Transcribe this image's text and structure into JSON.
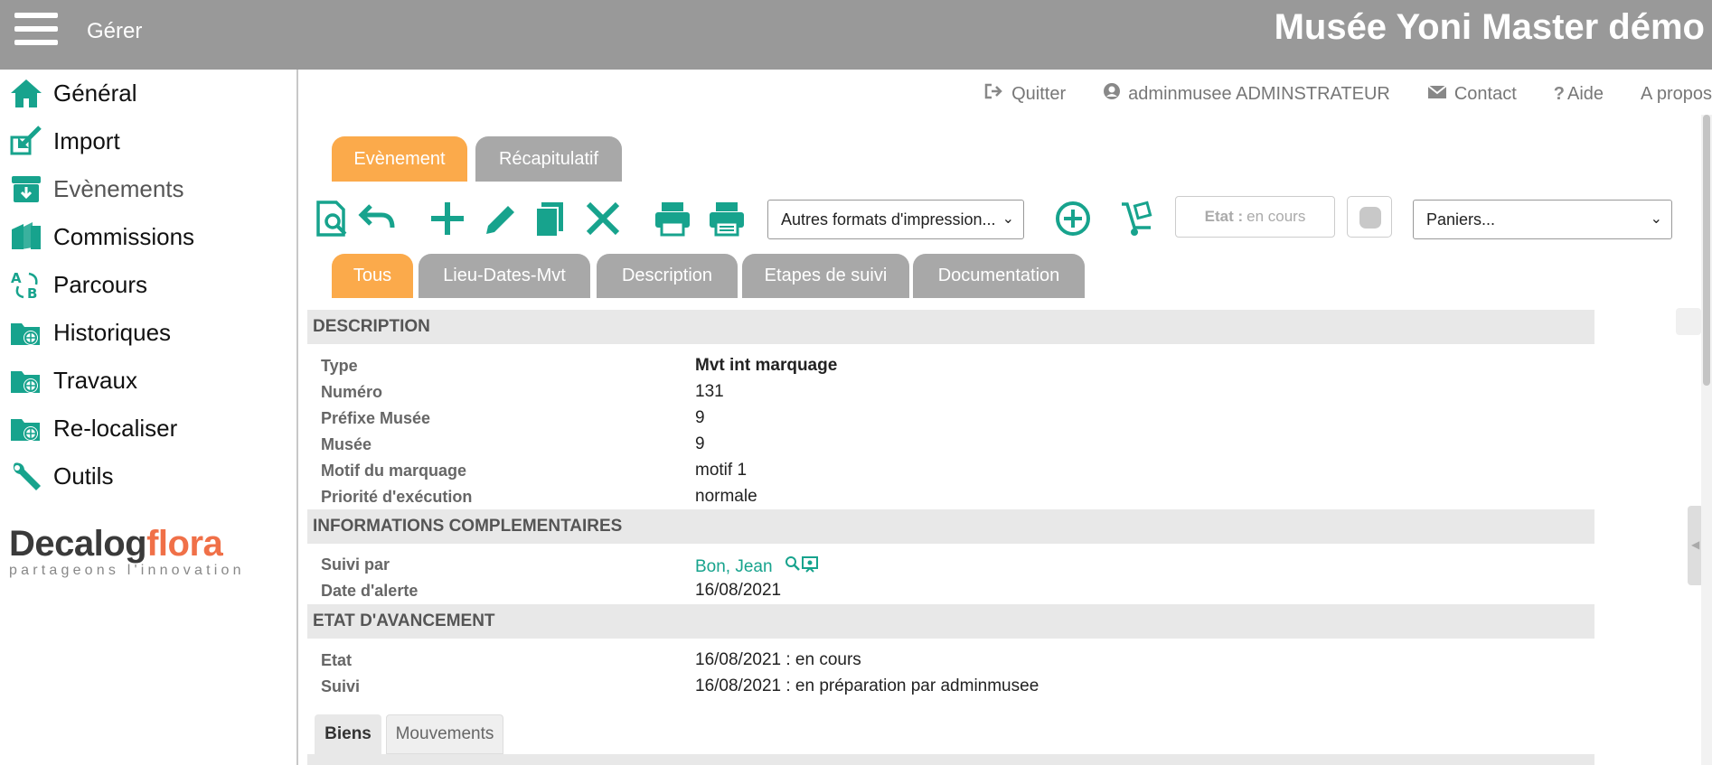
{
  "header": {
    "menu_label": "Gérer",
    "title": "Musée Yoni Master démo"
  },
  "sidebar": {
    "items": [
      {
        "label": "Général",
        "icon": "home-icon"
      },
      {
        "label": "Import",
        "icon": "import-icon"
      },
      {
        "label": "Evènements",
        "icon": "events-icon"
      },
      {
        "label": "Commissions",
        "icon": "commissions-icon"
      },
      {
        "label": "Parcours",
        "icon": "parcours-icon"
      },
      {
        "label": "Historiques",
        "icon": "historiques-icon"
      },
      {
        "label": "Travaux",
        "icon": "travaux-icon"
      },
      {
        "label": "Re-localiser",
        "icon": "relocaliser-icon"
      },
      {
        "label": "Outils",
        "icon": "wrench-icon"
      }
    ],
    "active_index": 2,
    "logo": {
      "word1": "Decalog",
      "word2": "flora",
      "tagline": "partageons l'innovation"
    }
  },
  "toplinks": {
    "quit": "Quitter",
    "user": "adminmusee ADMINSTRATEUR",
    "contact": "Contact",
    "help": "Aide",
    "about": "A propos"
  },
  "main_tabs": [
    {
      "label": "Evènement",
      "active": true
    },
    {
      "label": "Récapitulatif",
      "active": false
    }
  ],
  "toolbar": {
    "print_formats": "Autres formats d'impression...",
    "etat_label": "Etat :",
    "etat_value": "en cours",
    "baskets": "Paniers...",
    "accent_color": "#17a38d"
  },
  "sub_tabs": [
    {
      "label": "Tous",
      "active": true
    },
    {
      "label": "Lieu-Dates-Mvt",
      "active": false
    },
    {
      "label": "Description",
      "active": false
    },
    {
      "label": "Etapes de suivi",
      "active": false
    },
    {
      "label": "Documentation",
      "active": false
    }
  ],
  "sections": {
    "description": {
      "title": "DESCRIPTION",
      "fields": [
        {
          "label": "Type",
          "value": "Mvt int marquage"
        },
        {
          "label": "Numéro",
          "value": "131"
        },
        {
          "label": "Préfixe Musée",
          "value": "9"
        },
        {
          "label": "Musée",
          "value": "9"
        },
        {
          "label": "Motif du marquage",
          "value": "motif 1"
        },
        {
          "label": "Priorité d'exécution",
          "value": "normale"
        }
      ]
    },
    "complementaires": {
      "title": "INFORMATIONS COMPLEMENTAIRES",
      "fields": [
        {
          "label": "Suivi par",
          "value": "Bon, Jean"
        },
        {
          "label": "Date d'alerte",
          "value": "16/08/2021"
        }
      ]
    },
    "avancement": {
      "title": "ETAT D'AVANCEMENT",
      "fields": [
        {
          "label": "Etat",
          "value": "16/08/2021 : en cours"
        },
        {
          "label": "Suivi",
          "value": "16/08/2021 : en préparation par adminmusee"
        }
      ]
    }
  },
  "bottom_tabs": [
    {
      "label": "Biens",
      "active": true
    },
    {
      "label": "Mouvements",
      "active": false
    }
  ]
}
